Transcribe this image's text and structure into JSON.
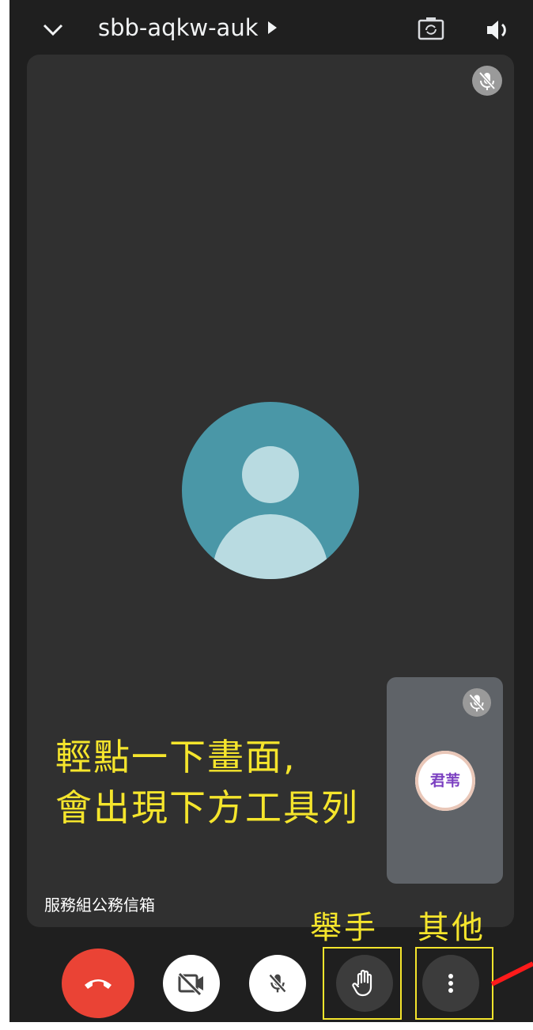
{
  "topbar": {
    "meeting_code": "sbb-aqkw-auk",
    "icons": [
      "chevron-down-icon",
      "switch-camera-icon",
      "speaker-icon"
    ]
  },
  "main_tile": {
    "status_icon": "mic-off-icon",
    "participant_name": "服務組公務信箱"
  },
  "self_tile": {
    "status_icon": "mic-off-icon",
    "avatar_text": "君苇"
  },
  "annotation": {
    "line1": "輕點一下畫面,",
    "line2": "會出現下方工具列",
    "raise_hand_caption": "舉手",
    "more_caption": "其他",
    "highlight_color": "#f5e52c",
    "arrow_color": "#ff1a1a"
  },
  "controls": [
    {
      "name": "end-call",
      "icon": "hang-up-icon",
      "color": "#ea4335"
    },
    {
      "name": "camera-toggle",
      "icon": "camera-off-icon",
      "color": "#ffffff"
    },
    {
      "name": "mic-toggle",
      "icon": "mic-off-icon",
      "color": "#ffffff"
    },
    {
      "name": "raise-hand",
      "icon": "hand-icon",
      "color": "#3c3c3c"
    },
    {
      "name": "more-options",
      "icon": "more-vert-icon",
      "color": "#3c3c3c"
    }
  ]
}
